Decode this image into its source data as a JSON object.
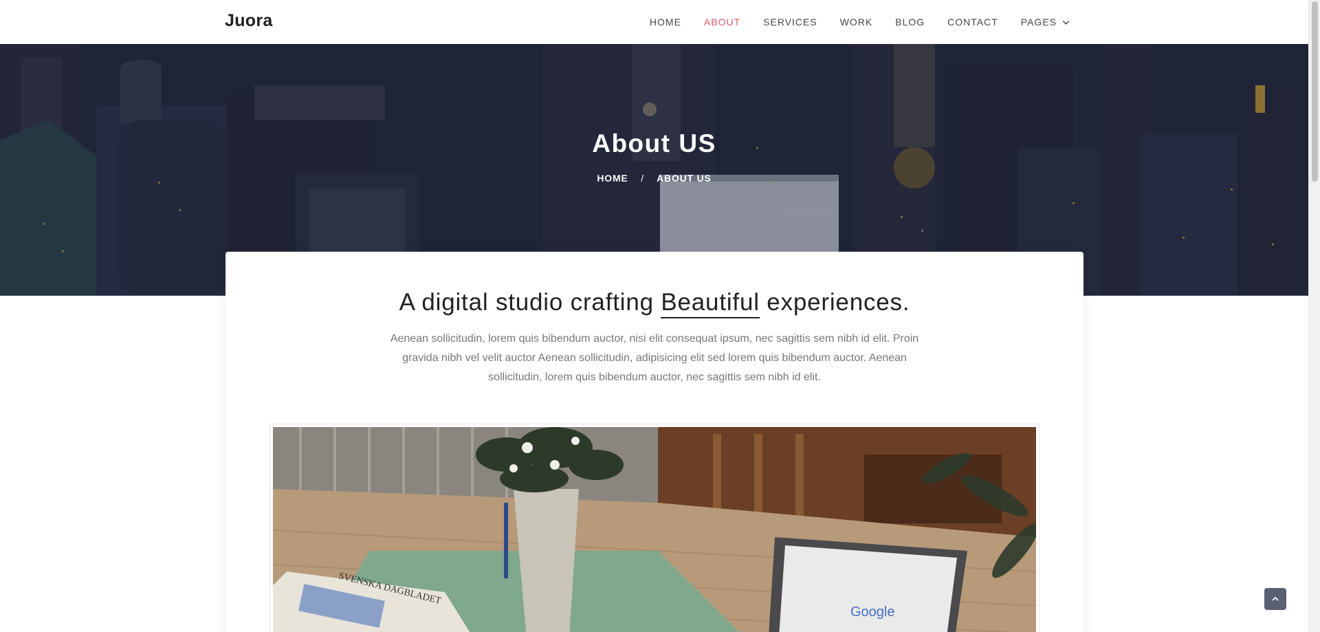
{
  "brand": "Juora",
  "nav": {
    "items": [
      {
        "label": "HOME",
        "active": false
      },
      {
        "label": "ABOUT",
        "active": true
      },
      {
        "label": "SERVICES",
        "active": false
      },
      {
        "label": "WORK",
        "active": false
      },
      {
        "label": "BLOG",
        "active": false
      },
      {
        "label": "CONTACT",
        "active": false
      },
      {
        "label": "PAGES",
        "active": false,
        "dropdown": true
      }
    ],
    "active_color": "#e05a6b"
  },
  "hero": {
    "title": "About US",
    "breadcrumb": {
      "home": "HOME",
      "separator": "/",
      "current": "ABOUT US"
    },
    "building_sign": "KEMPER"
  },
  "intro": {
    "headline_before": "A digital studio crafting ",
    "headline_highlight": "Beautiful",
    "headline_after": " experiences.",
    "body": "Aenean sollicitudin, lorem quis bibendum auctor, nisi elit consequat ipsum, nec sagittis sem nibh id elit. Proin gravida nibh vel velit auctor Aenean sollicitudin, adipisicing elit sed lorem quis bibendum auctor. Aenean sollicitudin, lorem quis bibendum auctor, nec sagittis sem nibh id elit."
  },
  "photo": {
    "screen_text": "Google",
    "newspaper_text": "SVENSKA DAGBLADET"
  },
  "icons": {
    "pages_dropdown": "chevron-down-icon",
    "back_to_top": "chevron-up-icon"
  }
}
